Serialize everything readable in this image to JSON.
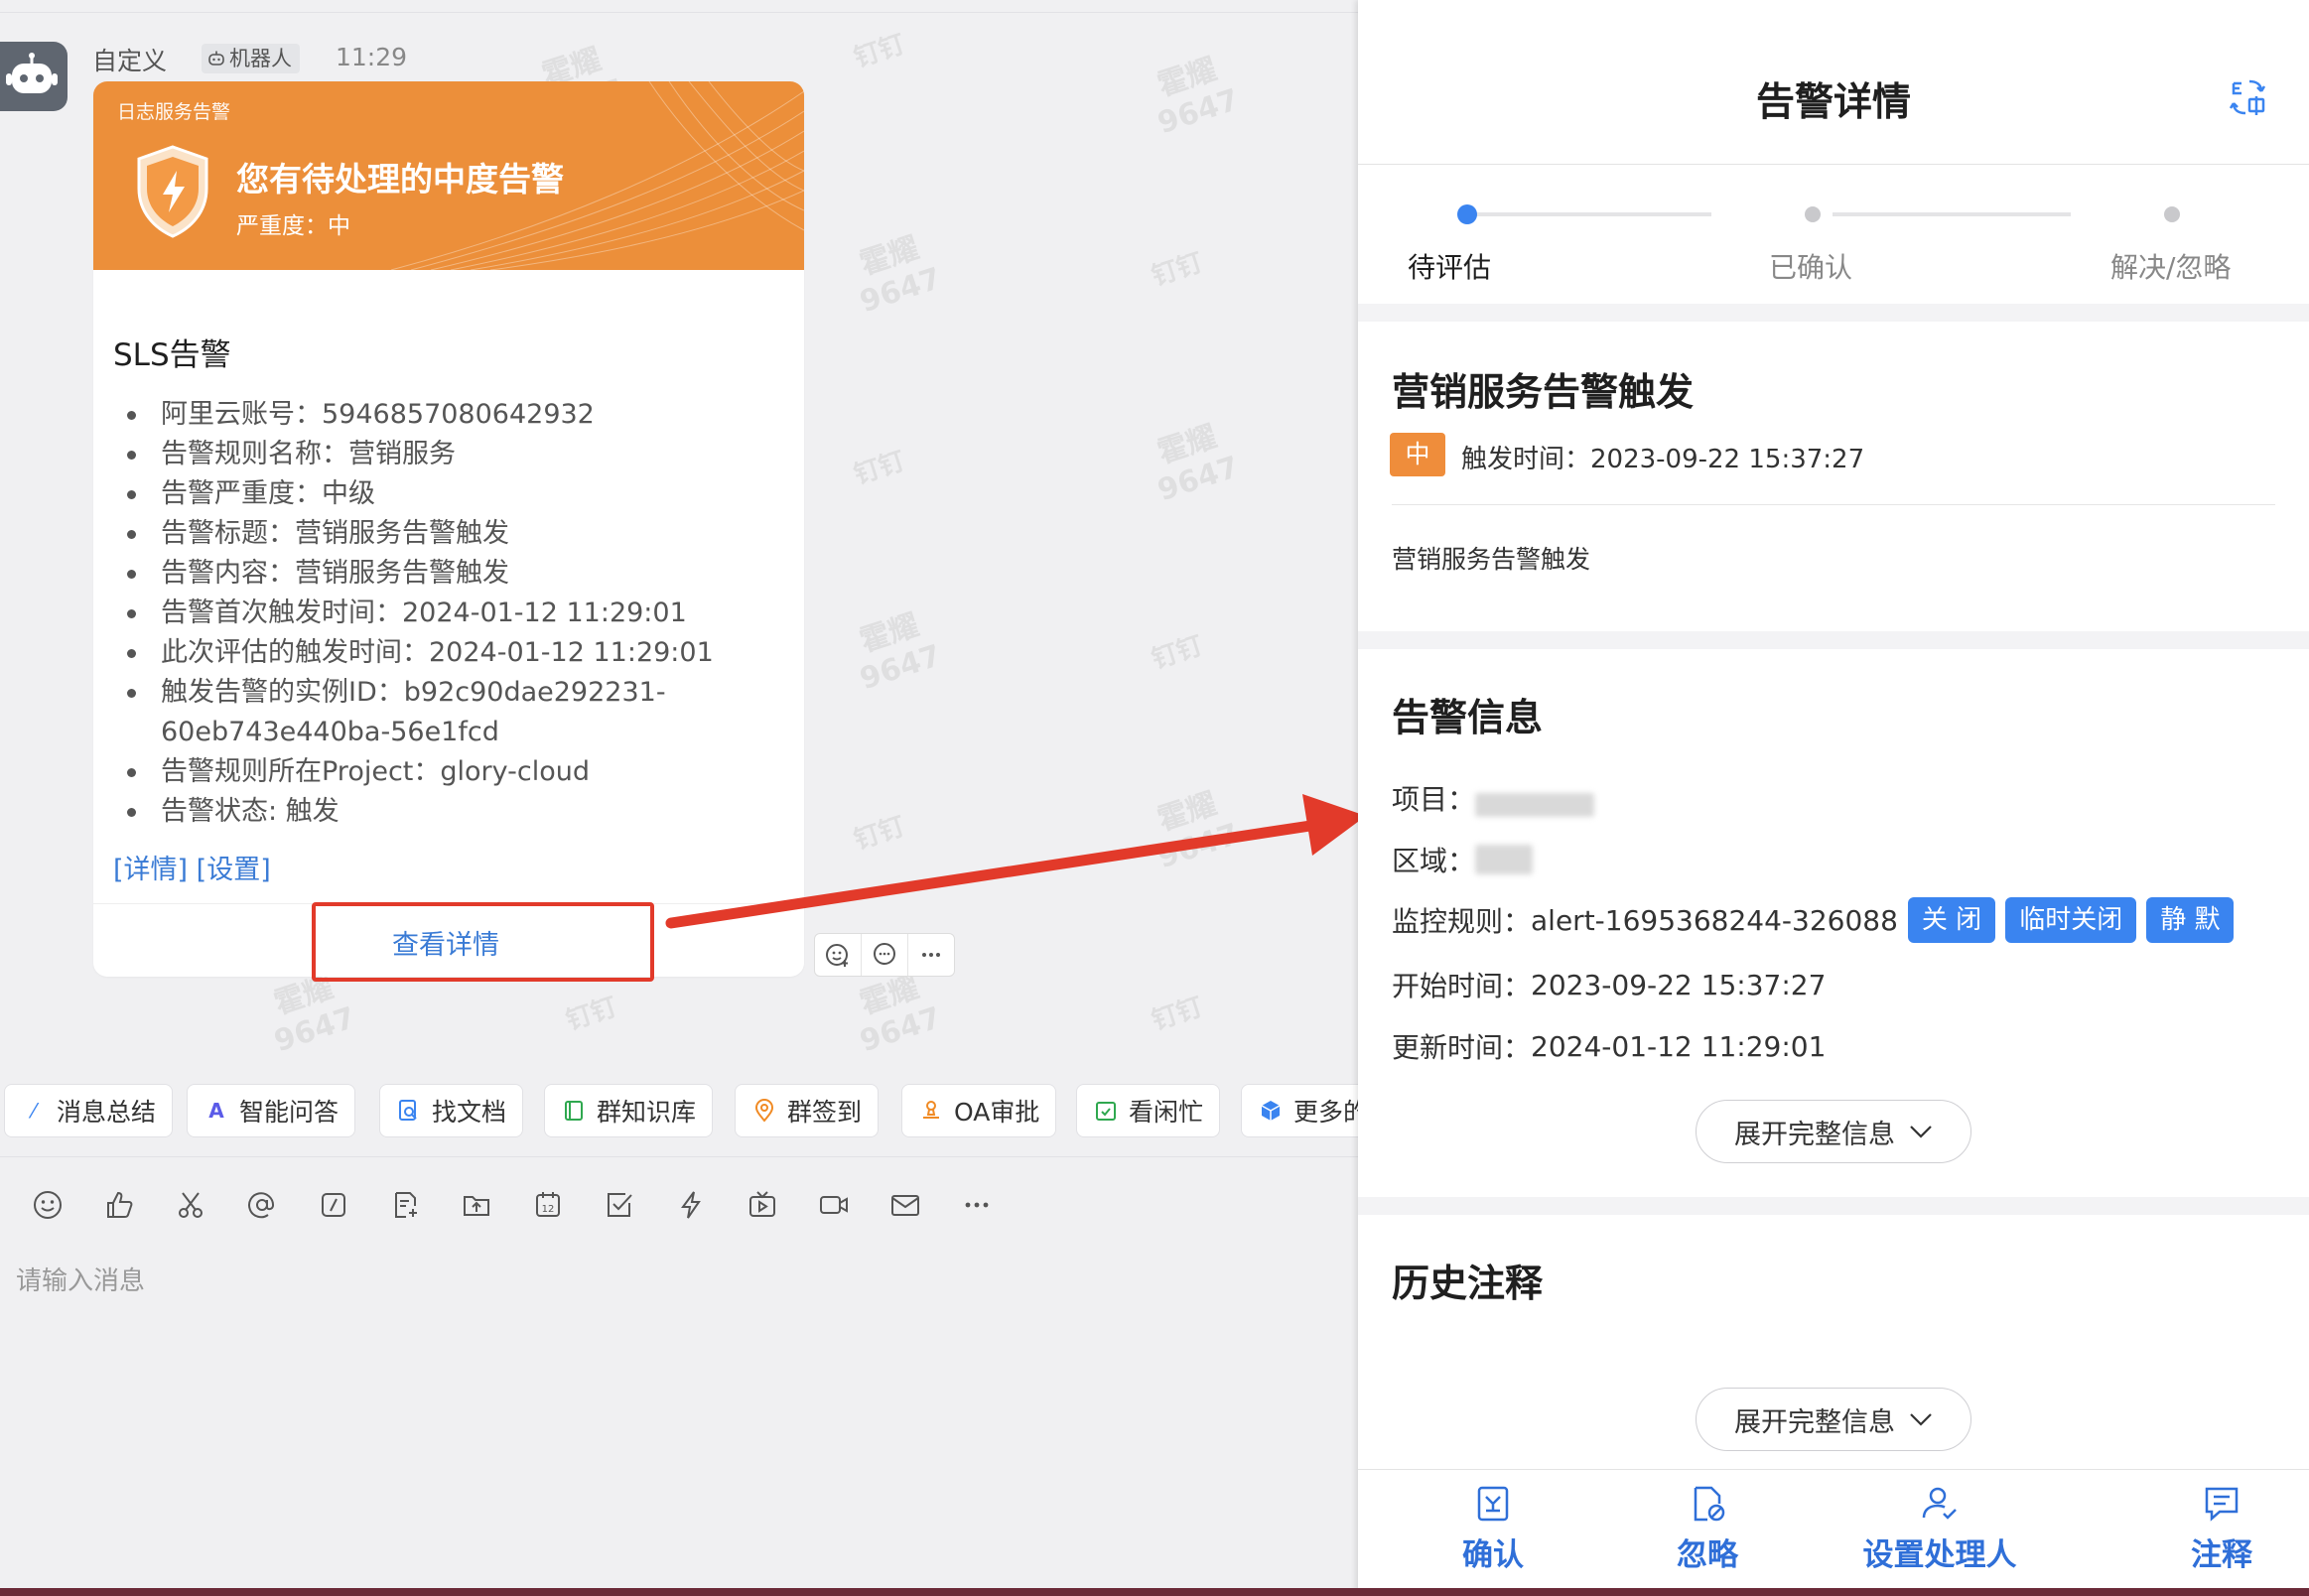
{
  "chat": {
    "sender": "自定义",
    "bot_tag": "机器人",
    "time": "11:29",
    "watermark_name": "霍耀",
    "watermark_id": "9647",
    "watermark_app": "钉钉",
    "card": {
      "hero_subtitle": "日志服务告警",
      "hero_title": "您有待处理的中度告警",
      "hero_severity": "严重度：中",
      "title": "SLS告警",
      "items": [
        "阿里云账号：5946857080642932",
        "告警规则名称：营销服务",
        "告警严重度：中级",
        "告警标题：营销服务告警触发",
        "告警内容：营销服务告警触发",
        "告警首次触发时间：2024-01-12 11:29:01",
        "此次评估的触发时间：2024-01-12 11:29:01",
        "触发告警的实例ID：b92c90dae292231-60eb743e440ba-56e1fcd",
        "告警规则所在Project：glory-cloud",
        "告警状态: 触发"
      ],
      "link_detail": "[详情]",
      "link_settings": "[设置]",
      "view_detail": "查看详情"
    },
    "quick_actions": [
      "消息总结",
      "智能问答",
      "找文档",
      "群知识库",
      "群签到",
      "OA审批",
      "看闲忙",
      "更多的"
    ],
    "input_placeholder": "请输入消息"
  },
  "detail": {
    "title": "告警详情",
    "steps": [
      "待评估",
      "已确认",
      "解决/忽略"
    ],
    "alert": {
      "title": "营销服务告警触发",
      "severity": "中",
      "trigger_time": "触发时间：2023-09-22 15:37:27",
      "description": "营销服务告警触发"
    },
    "info": {
      "title": "告警信息",
      "project_label": "项目：",
      "region_label": "区域：",
      "rule_label": "监控规则：",
      "rule_value": "alert-1695368244-326088",
      "btn_close": "关 闭",
      "btn_temp_close": "临时关闭",
      "btn_mute": "静 默",
      "start_label": "开始时间：",
      "start_value": "2023-09-22 15:37:27",
      "update_label": "更新时间：",
      "update_value": "2024-01-12 11:29:01",
      "expand": "展开完整信息"
    },
    "history": {
      "title": "历史注释",
      "expand": "展开完整信息"
    },
    "bottom_nav": [
      "确认",
      "忽略",
      "设置处理人",
      "注释"
    ]
  },
  "colors": {
    "hero_orange": "#ec8f3a",
    "link_blue": "#3a7bd5",
    "action_blue": "#3a84f0",
    "arrow_red": "#e23a2a",
    "badge_orange": "#ef8d3b"
  }
}
